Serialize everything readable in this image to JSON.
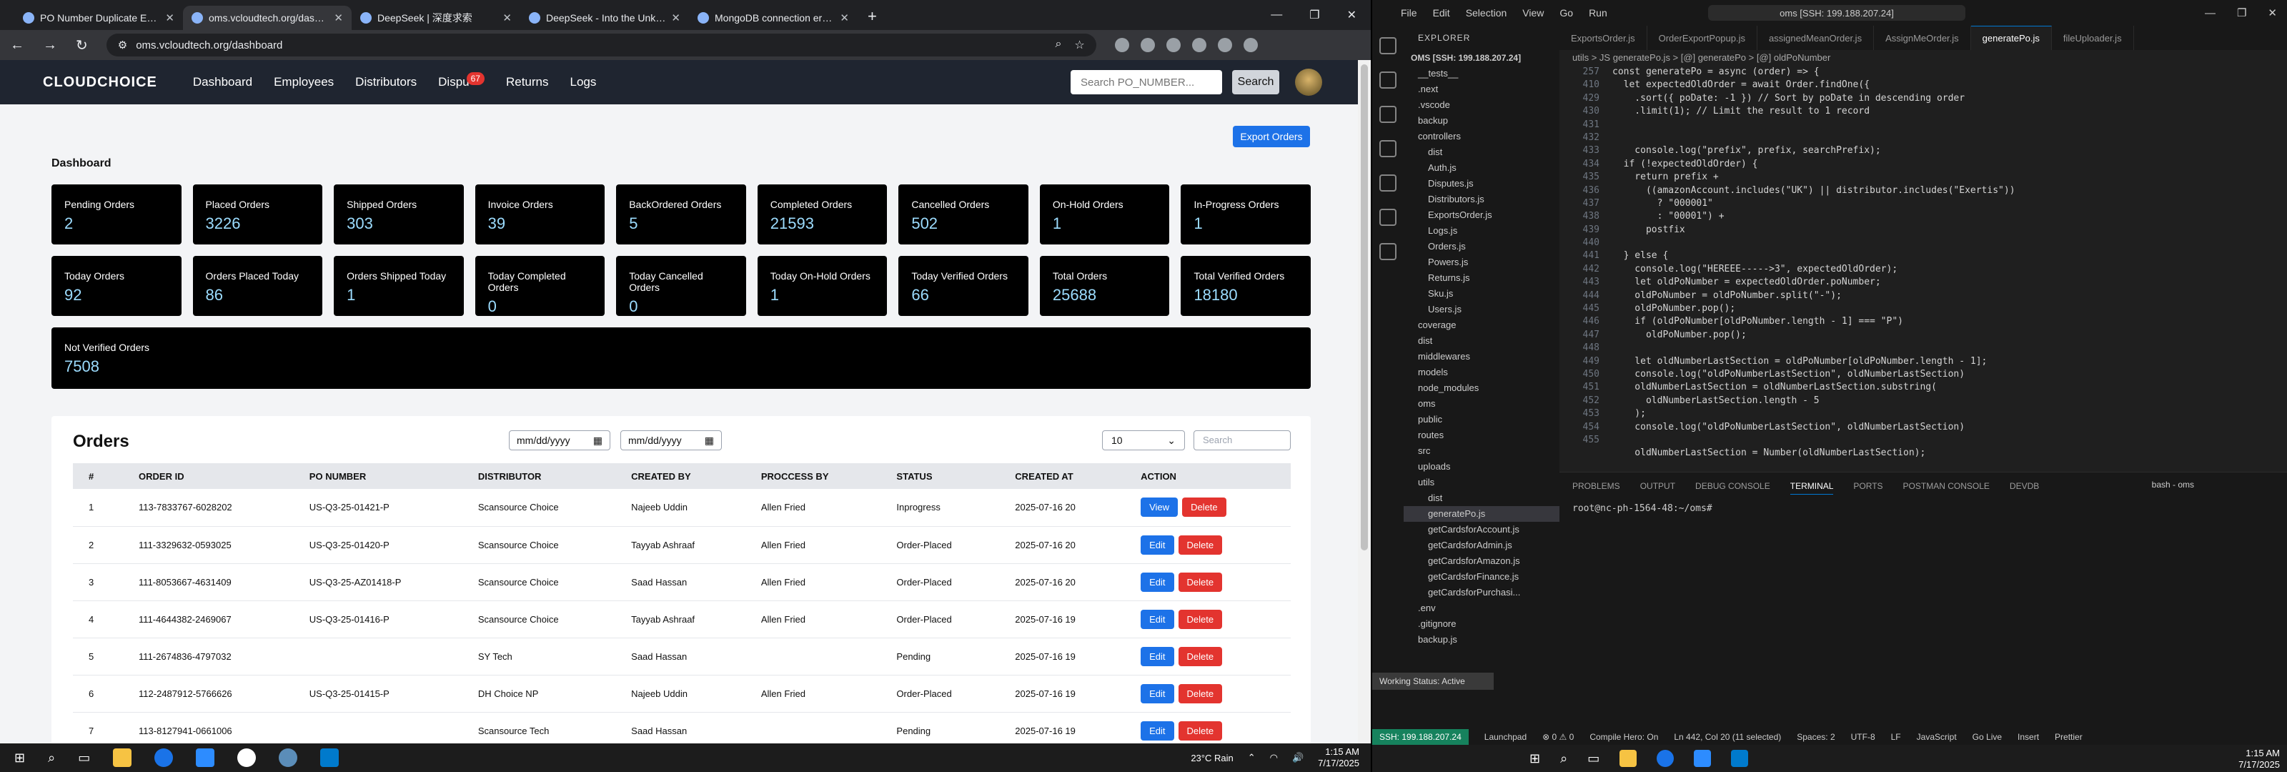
{
  "browser": {
    "tabs": [
      {
        "title": "PO Number Duplicate Error Exp",
        "active": false
      },
      {
        "title": "oms.vcloudtech.org/dashboard",
        "active": true
      },
      {
        "title": "DeepSeek | 深度求索",
        "active": false
      },
      {
        "title": "DeepSeek - Into the Unknown",
        "active": false
      },
      {
        "title": "MongoDB connection error fix",
        "active": false
      }
    ],
    "url": "oms.vcloudtech.org/dashboard"
  },
  "app": {
    "logo": "CLOUDCHOICE",
    "nav": [
      "Dashboard",
      "Employees",
      "Distributors",
      "Disputes",
      "Returns",
      "Logs"
    ],
    "disputes_label": "Dispu",
    "disputes_badge": "67",
    "search_placeholder": "Search PO_NUMBER...",
    "search_button": "Search",
    "export_button": "Export Orders",
    "dashboard_title": "Dashboard",
    "cards": [
      {
        "label": "Pending Orders",
        "value": "2"
      },
      {
        "label": "Placed Orders",
        "value": "3226"
      },
      {
        "label": "Shipped Orders",
        "value": "303"
      },
      {
        "label": "Invoice Orders",
        "value": "39"
      },
      {
        "label": "BackOrdered Orders",
        "value": "5"
      },
      {
        "label": "Completed Orders",
        "value": "21593"
      },
      {
        "label": "Cancelled Orders",
        "value": "502"
      },
      {
        "label": "On-Hold Orders",
        "value": "1"
      },
      {
        "label": "In-Progress Orders",
        "value": "1"
      },
      {
        "label": "Today Orders",
        "value": "92"
      },
      {
        "label": "Orders Placed Today",
        "value": "86"
      },
      {
        "label": "Orders Shipped Today",
        "value": "1"
      },
      {
        "label": "Today Completed Orders",
        "value": "0"
      },
      {
        "label": "Today Cancelled Orders",
        "value": "0"
      },
      {
        "label": "Today On-Hold Orders",
        "value": "1"
      },
      {
        "label": "Today Verified Orders",
        "value": "66"
      },
      {
        "label": "Total Orders",
        "value": "25688"
      },
      {
        "label": "Total Verified Orders",
        "value": "18180"
      },
      {
        "label": "Not Verified Orders",
        "value": "7508"
      }
    ],
    "orders": {
      "title": "Orders",
      "date_from": "mm/dd/yyyy",
      "date_to": "mm/dd/yyyy",
      "page_size": "10",
      "search_placeholder": "Search",
      "columns": [
        "#",
        "ORDER ID",
        "PO NUMBER",
        "DISTRIBUTOR",
        "CREATED BY",
        "PROCCESS BY",
        "STATUS",
        "CREATED AT",
        "ACTION"
      ],
      "rows": [
        {
          "n": "1",
          "order_id": "113-7833767-6028202",
          "po": "US-Q3-25-01421-P",
          "distributor": "Scansource Choice",
          "created_by": "Najeeb Uddin",
          "process_by": "Allen Fried",
          "status": "Inprogress",
          "created_at": "2025-07-16 20",
          "primary": "View"
        },
        {
          "n": "2",
          "order_id": "111-3329632-0593025",
          "po": "US-Q3-25-01420-P",
          "distributor": "Scansource Choice",
          "created_by": "Tayyab Ashraaf",
          "process_by": "Allen Fried",
          "status": "Order-Placed",
          "created_at": "2025-07-16 20",
          "primary": "Edit"
        },
        {
          "n": "3",
          "order_id": "111-8053667-4631409",
          "po": "US-Q3-25-AZ01418-P",
          "distributor": "Scansource Choice",
          "created_by": "Saad Hassan",
          "process_by": "Allen Fried",
          "status": "Order-Placed",
          "created_at": "2025-07-16 20",
          "primary": "Edit"
        },
        {
          "n": "4",
          "order_id": "111-4644382-2469067",
          "po": "US-Q3-25-01416-P",
          "distributor": "Scansource Choice",
          "created_by": "Tayyab Ashraaf",
          "process_by": "Allen Fried",
          "status": "Order-Placed",
          "created_at": "2025-07-16 19",
          "primary": "Edit"
        },
        {
          "n": "5",
          "order_id": "111-2674836-4797032",
          "po": "",
          "distributor": "SY Tech",
          "created_by": "Saad Hassan",
          "process_by": "",
          "status": "Pending",
          "created_at": "2025-07-16 19",
          "primary": "Edit"
        },
        {
          "n": "6",
          "order_id": "112-2487912-5766626",
          "po": "US-Q3-25-01415-P",
          "distributor": "DH Choice NP",
          "created_by": "Najeeb Uddin",
          "process_by": "Allen Fried",
          "status": "Order-Placed",
          "created_at": "2025-07-16 19",
          "primary": "Edit"
        },
        {
          "n": "7",
          "order_id": "113-8127941-0661006",
          "po": "",
          "distributor": "Scansource Tech",
          "created_by": "Saad Hassan",
          "process_by": "",
          "status": "Pending",
          "created_at": "2025-07-16 19",
          "primary": "Edit"
        }
      ],
      "delete_label": "Delete"
    }
  },
  "taskbar_left": {
    "weather": "23°C  Rain",
    "time": "1:15 AM",
    "date": "7/17/2025"
  },
  "vscode": {
    "menu": [
      "File",
      "Edit",
      "Selection",
      "View",
      "Go",
      "Run"
    ],
    "command_center": "oms [SSH: 199.188.207.24]",
    "explorer_title": "EXPLORER",
    "root": "OMS [SSH: 199.188.207.24]",
    "tree": [
      "__tests__",
      ".next",
      ".vscode",
      "backup",
      "controllers",
      "dist",
      "Auth.js",
      "Disputes.js",
      "Distributors.js",
      "ExportsOrder.js",
      "Logs.js",
      "Orders.js",
      "Powers.js",
      "Returns.js",
      "Sku.js",
      "Users.js",
      "coverage",
      "dist",
      "middlewares",
      "models",
      "node_modules",
      "oms",
      "public",
      "routes",
      "src",
      "uploads",
      "utils",
      "dist",
      "generatePo.js",
      "getCardsforAccount.js",
      "getCardsforAdmin.js",
      "getCardsforAmazon.js",
      "getCardsforFinance.js",
      "getCardsforPurchasi...",
      ".env",
      ".gitignore",
      "backup.js"
    ],
    "tabs": [
      "ExportsOrder.js",
      "OrderExportPopup.js",
      "assignedMeanOrder.js",
      "AssignMeOrder.js",
      "generatePo.js",
      "fileUploader.js"
    ],
    "breadcrumb": "utils > JS generatePo.js > [@] generatePo > [@] oldPoNumber",
    "line_numbers": [
      "257",
      "410",
      "429",
      "430",
      "431",
      "432",
      "433",
      "434",
      "435",
      "436",
      "437",
      "438",
      "439",
      "440",
      "441",
      "442",
      "443",
      "444",
      "445",
      "446",
      "447",
      "448",
      "449",
      "450",
      "451",
      "452",
      "453",
      "454",
      "455"
    ],
    "code": [
      "const generatePo = async (order) => {",
      "  let expectedOldOrder = await Order.findOne({",
      "    .sort({ poDate: -1 }) // Sort by poDate in descending order",
      "    .limit(1); // Limit the result to 1 record",
      "",
      "",
      "    console.log(\"prefix\", prefix, searchPrefix);",
      "  if (!expectedOldOrder) {",
      "    return prefix +",
      "      ((amazonAccount.includes(\"UK\") || distributor.includes(\"Exertis\"))",
      "        ? \"000001\"",
      "        : \"00001\") +",
      "      postfix",
      "",
      "  } else {",
      "    console.log(\"HEREEE----->3\", expectedOldOrder);",
      "    let oldPoNumber = expectedOldOrder.poNumber;",
      "    oldPoNumber = oldPoNumber.split(\"-\");",
      "    oldPoNumber.pop();",
      "    if (oldPoNumber[oldPoNumber.length - 1] === \"P\")",
      "      oldPoNumber.pop();",
      "",
      "    let oldNumberLastSection = oldPoNumber[oldPoNumber.length - 1];",
      "    console.log(\"oldPoNumberLastSection\", oldNumberLastSection)",
      "    oldNumberLastSection = oldNumberLastSection.substring(",
      "      oldNumberLastSection.length - 5",
      "    );",
      "    console.log(\"oldPoNumberLastSection\", oldNumberLastSection)",
      "",
      "    oldNumberLastSection = Number(oldNumberLastSection);"
    ],
    "panel_tabs": [
      "PROBLEMS",
      "OUTPUT",
      "DEBUG CONSOLE",
      "TERMINAL",
      "PORTS",
      "POSTMAN CONSOLE",
      "DEVDB"
    ],
    "terminal_shell": "bash - oms",
    "terminal_line": "root@nc-ph-1564-48:~/oms#",
    "status": {
      "remote": "SSH: 199.188.207.24",
      "launchpad": "Launchpad",
      "problems": "⊗ 0  ⚠ 0",
      "compile": "Compile Hero: On",
      "position": "Ln 442, Col 20 (11 selected)",
      "spaces": "Spaces: 2",
      "encoding": "UTF-8",
      "eol": "LF",
      "language": "JavaScript",
      "golive": "Go Live",
      "insert": "Insert",
      "prettier": "Prettier"
    },
    "working_status": "Working Status: Active",
    "clock": {
      "time": "1:15 AM",
      "date": "7/17/2025"
    }
  }
}
